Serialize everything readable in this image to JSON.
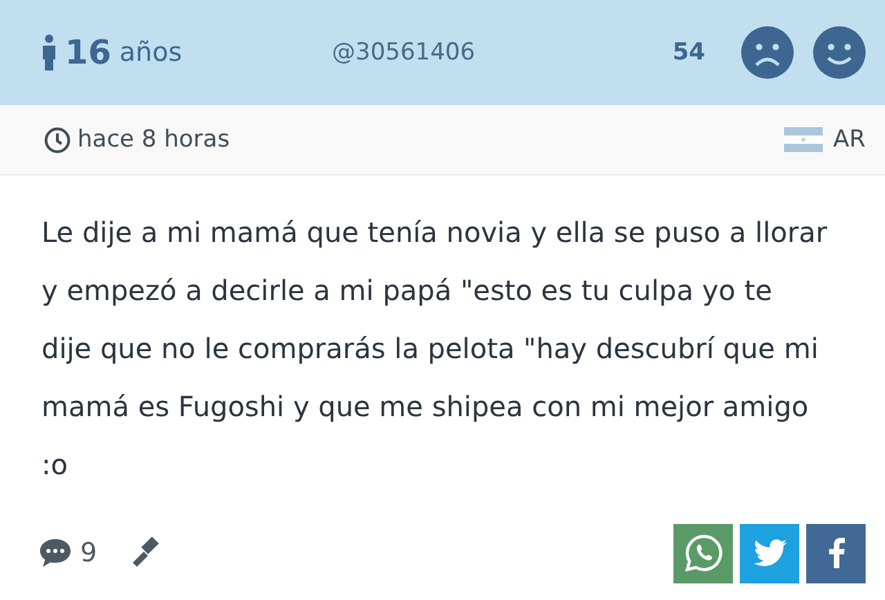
{
  "header": {
    "age": "16",
    "age_unit": "años",
    "user": "@30561406",
    "votes": "54"
  },
  "meta": {
    "time": "hace 8 horas",
    "country": "AR"
  },
  "post": {
    "text": "Le dije a mi mamá que tenía novia y ella se puso a llorar y empezó a decirle a mi papá \"esto es tu culpa yo te dije que no le comprarás la pelota \"hay descubrí que mi mamá es Fugoshi y que me shipea con mi mejor amigo :o"
  },
  "footer": {
    "comments": "9",
    "share": [
      {
        "kind": "whatsapp",
        "color": "#5a9a66"
      },
      {
        "kind": "twitter",
        "color": "#1da1df"
      },
      {
        "kind": "facebook",
        "color": "#426996"
      }
    ]
  }
}
